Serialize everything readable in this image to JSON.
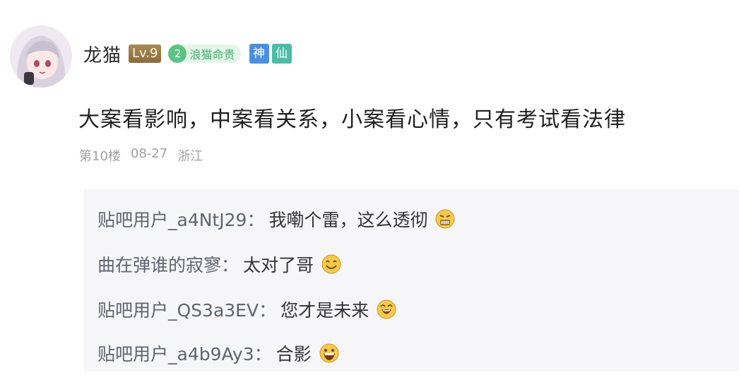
{
  "post": {
    "username": "龙猫",
    "level": "Lv.9",
    "title_badge": {
      "number": "2",
      "text": "浪猫命贵"
    },
    "tags": [
      "神",
      "仙"
    ],
    "content": "大案看影响，中案看关系，小案看心情，只有考试看法律",
    "meta": {
      "floor": "第10楼",
      "date": "08-27",
      "location": "浙江"
    }
  },
  "replies": [
    {
      "name": "贴吧用户_a4NtJ29",
      "sep": "：",
      "text": "我嘞个雷，这么透彻",
      "emoji": "grimace-emoji"
    },
    {
      "name": "曲在弹谁的寂寥",
      "sep": "：",
      "text": "太对了哥",
      "emoji": "smile-emoji"
    },
    {
      "name": "贴吧用户_QS3a3EV",
      "sep": "：",
      "text": "您才是未来",
      "emoji": "laugh-emoji"
    },
    {
      "name": "贴吧用户_a4b9Ay3",
      "sep": "：",
      "text": "合影",
      "emoji": "grin-emoji"
    }
  ],
  "colors": {
    "level_badge": "#8c6c3c",
    "title_badge": "#5cc384",
    "tag_blue": "#4a8fe0",
    "tag_teal": "#4cbca8",
    "reply_bg": "#f6f6f8"
  }
}
